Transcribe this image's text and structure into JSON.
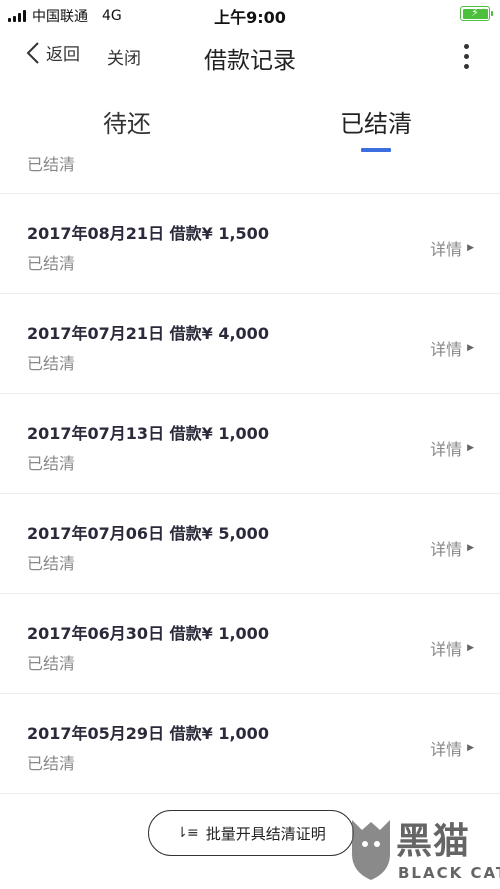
{
  "status_bar": {
    "carrier": "中国联通",
    "network": "4G",
    "time": "上午9:00",
    "battery_color": "#4cbf3c"
  },
  "nav": {
    "back_label": "返回",
    "close_label": "关闭",
    "title": "借款记录"
  },
  "tabs": {
    "pending": "待还",
    "settled": "已结清",
    "active_color": "#3c6ee0"
  },
  "partial_row": {
    "status": "已结清"
  },
  "loans": [
    {
      "title": "2017年08月21日 借款¥ 1,500",
      "status": "已结清",
      "detail": "详情"
    },
    {
      "title": "2017年07月21日 借款¥ 4,000",
      "status": "已结清",
      "detail": "详情"
    },
    {
      "title": "2017年07月13日 借款¥ 1,000",
      "status": "已结清",
      "detail": "详情"
    },
    {
      "title": "2017年07月06日 借款¥ 5,000",
      "status": "已结清",
      "detail": "详情"
    },
    {
      "title": "2017年06月30日 借款¥ 1,000",
      "status": "已结清",
      "detail": "详情"
    },
    {
      "title": "2017年05月29日 借款¥ 1,000",
      "status": "已结清",
      "detail": "详情"
    }
  ],
  "footer": {
    "bulk_button_label": "批量开具结清证明"
  },
  "watermark": {
    "cn": "黑猫",
    "en": "BLACK CAT"
  }
}
